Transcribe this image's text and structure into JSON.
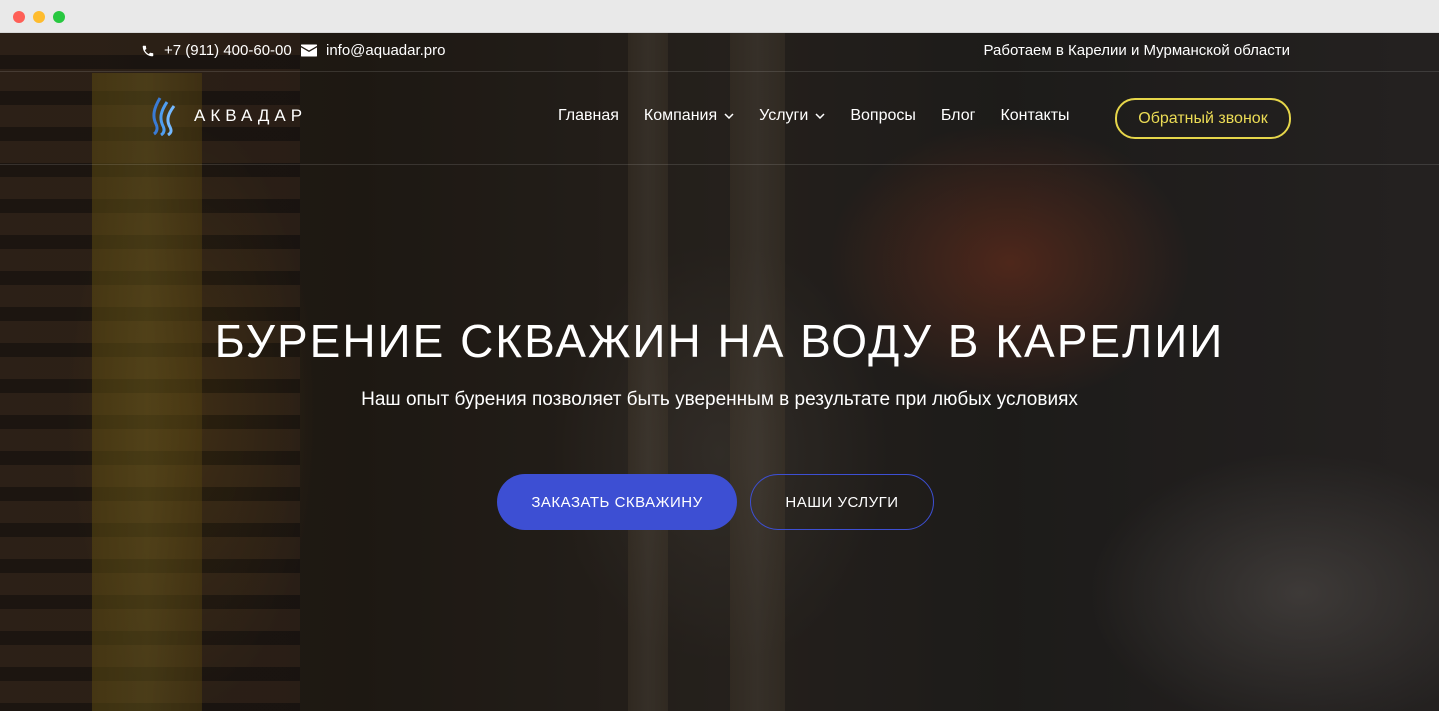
{
  "window": {
    "controls": [
      "close",
      "minimize",
      "maximize"
    ]
  },
  "topbar": {
    "phone": "+7 (911) 400-60-00",
    "email": "info@aquadar.pro",
    "region": "Работаем в Карелии и Мурманской области",
    "phone_icon": "phone-icon",
    "email_icon": "envelope-icon"
  },
  "header": {
    "logo_text": "АКВАДАР",
    "logo_icon": "water-drop-icon",
    "nav": [
      {
        "label": "Главная",
        "has_dropdown": false
      },
      {
        "label": "Компания",
        "has_dropdown": true
      },
      {
        "label": "Услуги",
        "has_dropdown": true
      },
      {
        "label": "Вопросы",
        "has_dropdown": false
      },
      {
        "label": "Блог",
        "has_dropdown": false
      },
      {
        "label": "Контакты",
        "has_dropdown": false
      }
    ],
    "callback_label": "Обратный звонок"
  },
  "hero": {
    "title": "БУРЕНИЕ СКВАЖИН НА ВОДУ В КАРЕЛИИ",
    "subtitle": "Наш опыт бурения позволяет быть уверенным в результате при любых условиях",
    "primary_button": "ЗАКАЗАТЬ СКВАЖИНУ",
    "secondary_button": "НАШИ УСЛУГИ"
  },
  "colors": {
    "accent_blue": "#3d4fd3",
    "accent_yellow": "#e6d64a",
    "text": "#ffffff"
  }
}
